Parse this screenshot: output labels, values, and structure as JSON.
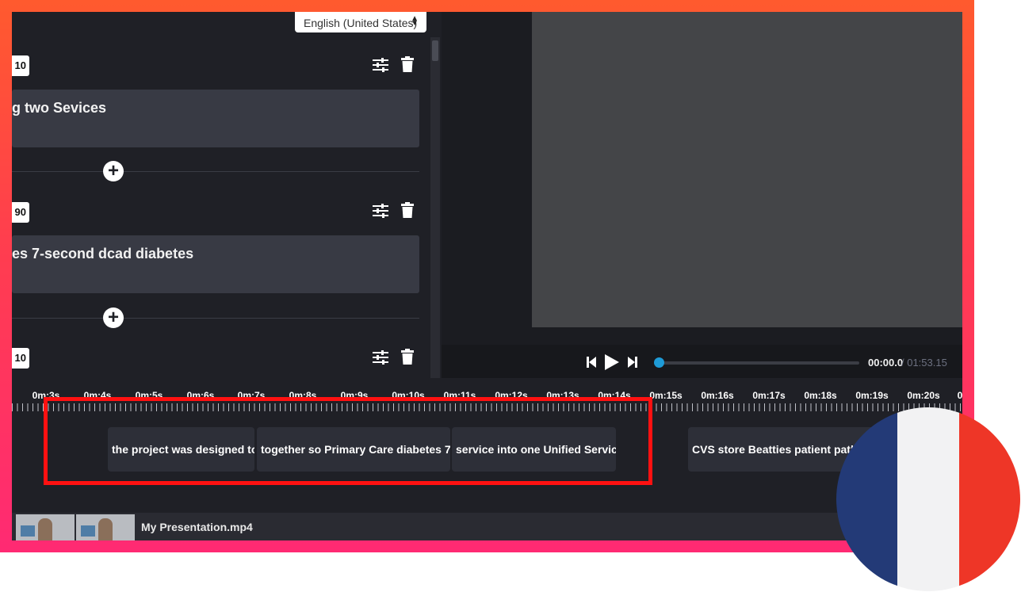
{
  "language_select": {
    "value": "English (United States)"
  },
  "captions": [
    {
      "tag": "10",
      "text": "g two Sevices"
    },
    {
      "tag": "90",
      "text": "es 7-second dcad diabetes"
    },
    {
      "tag": "10",
      "text": ""
    }
  ],
  "player": {
    "current_time": "00:00.0",
    "total_time": "/ 01:53.15"
  },
  "timeline": {
    "ticks": [
      "0m:3s",
      "0m:4s",
      "0m:5s",
      "0m:6s",
      "0m:7s",
      "0m:8s",
      "0m:9s",
      "0m:10s",
      "0m:11s",
      "0m:12s",
      "0m:13s",
      "0m:14s",
      "0m:15s",
      "0m:16s",
      "0m:17s",
      "0m:18s",
      "0m:19s",
      "0m:20s",
      "0"
    ],
    "clips": [
      "the project was designed to...",
      "together so Primary Care diabetes 7-...",
      "service into one Unified Servic...",
      "CVS store Beatties patient pathway"
    ],
    "video_file": "My Presentation.mp4"
  },
  "colors": {
    "frame": "#ff3d4f",
    "highlight": "#ff1111",
    "progress": "#1e9bd7"
  },
  "icons": [
    "sliders-icon",
    "trash-icon",
    "plus-circle-icon",
    "skip-back-icon",
    "play-icon",
    "skip-forward-icon",
    "france-flag-icon"
  ]
}
